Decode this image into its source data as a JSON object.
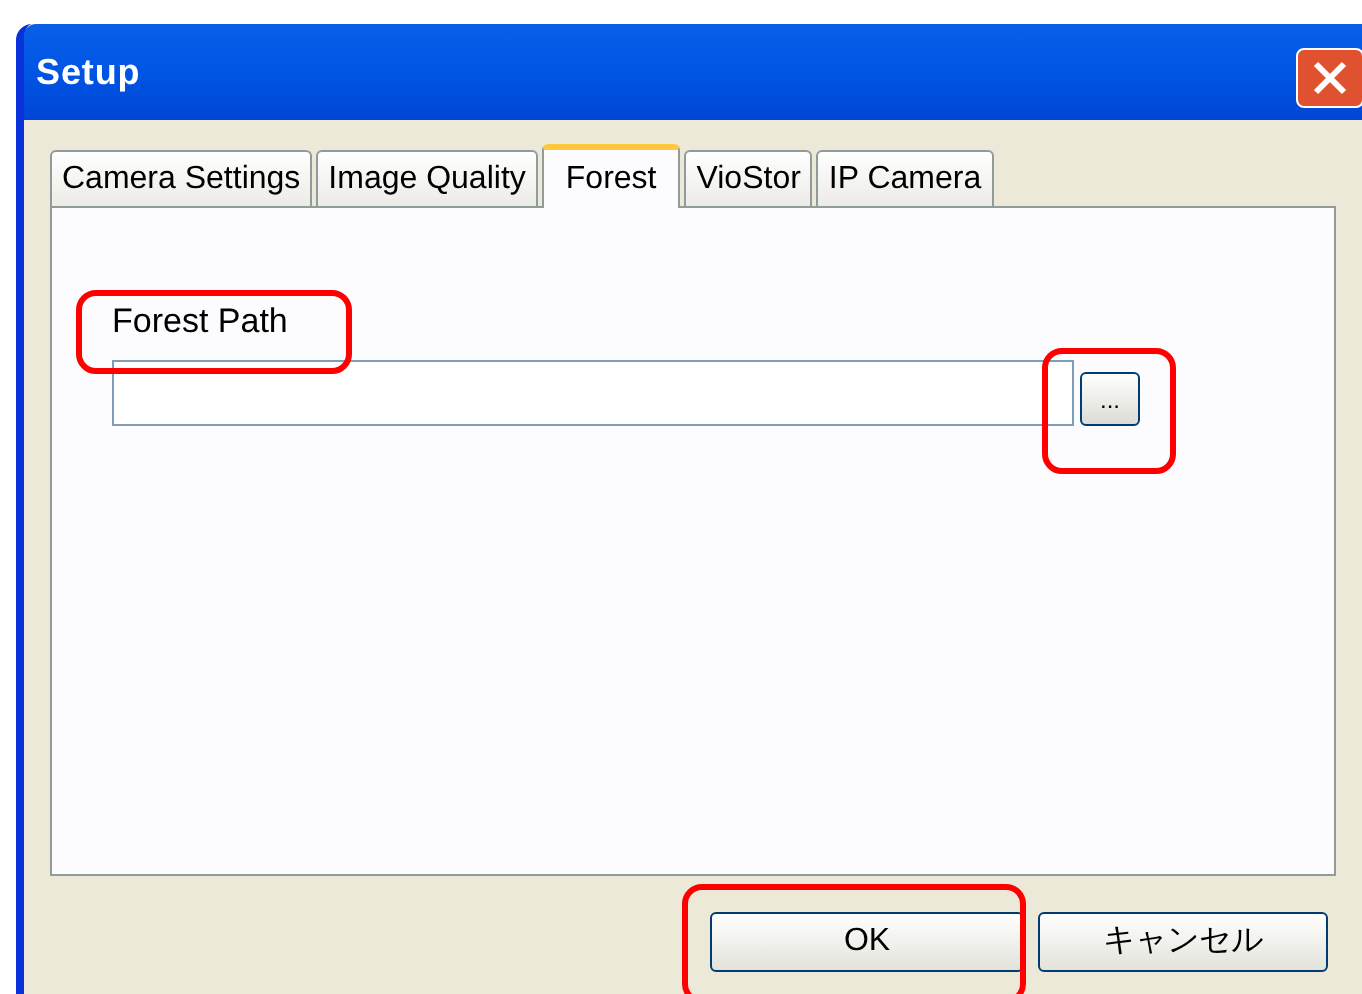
{
  "window": {
    "title": "Setup"
  },
  "tabs": [
    {
      "label": "Camera Settings",
      "selected": false
    },
    {
      "label": "Image Quality",
      "selected": false
    },
    {
      "label": "Forest",
      "selected": true
    },
    {
      "label": "VioStor",
      "selected": false
    },
    {
      "label": "IP Camera",
      "selected": false
    }
  ],
  "forest_path": {
    "label": "Forest Path",
    "highlighted": true,
    "browse_button": {
      "label": "...",
      "highlighted": true
    }
  },
  "buttons": [
    {
      "label": "OK",
      "highlighted": true
    },
    {
      "label": "キャンセル",
      "highlighted": false
    }
  ]
}
